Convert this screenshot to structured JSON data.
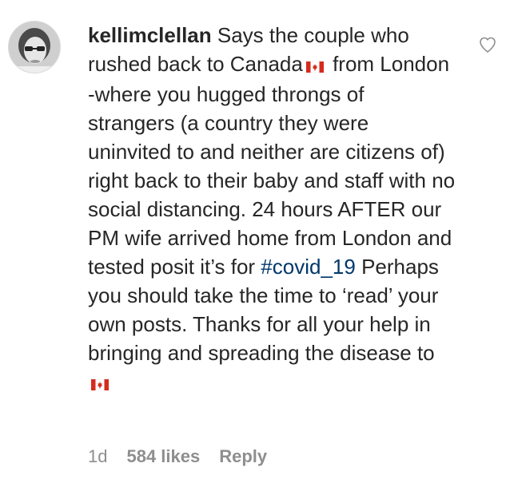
{
  "comment": {
    "username": "kellimclellan",
    "text_1": " Says the couple who rushed back to Canada",
    "flag_1": "canada-flag",
    "text_2": " from London -where you hugged throngs of strangers (a country they were uninvited to and neither are citizens of) right back to their baby and staff with no social distancing. 24 hours AFTER our PM wife arrived home from London and tested posit it’s for ",
    "hashtag": "#covid_19",
    "text_3": " Perhaps you should take the time to ‘read’ your own posts. Thanks for all your help in bringing and spreading the disease to",
    "flag_2": "canada-flag"
  },
  "meta": {
    "time": "1d",
    "likes": "584 likes",
    "reply": "Reply"
  },
  "colors": {
    "text": "#262626",
    "hashtag": "#00376b",
    "meta": "#8e8e8e",
    "flag_red": "#d52b1e"
  }
}
